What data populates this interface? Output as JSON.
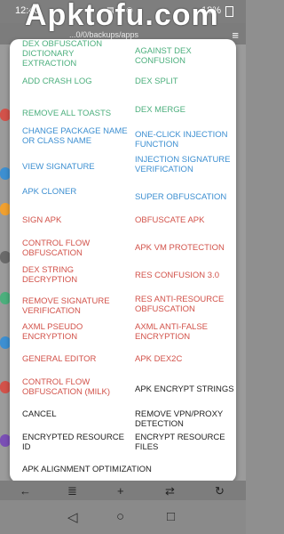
{
  "status": {
    "time": "12:40",
    "battery": "18%"
  },
  "watermark": "Apktofu.com",
  "path": "...0/0/backups/apps",
  "menu": [
    {
      "label": "DEX OBFUSCATION DICTIONARY EXTRACTION",
      "color": "green"
    },
    {
      "label": "AGAINST DEX CONFUSION",
      "color": "green"
    },
    {
      "label": "ADD CRASH LOG",
      "color": "green"
    },
    {
      "label": "DEX SPLIT",
      "color": "green"
    },
    {
      "label": "REMOVE ALL TOASTS",
      "color": "green"
    },
    {
      "label": "DEX MERGE",
      "color": "green"
    },
    {
      "label": "CHANGE PACKAGE NAME OR CLASS NAME",
      "color": "blue"
    },
    {
      "label": "ONE-CLICK INJECTION FUNCTION",
      "color": "blue"
    },
    {
      "label": "VIEW SIGNATURE",
      "color": "blue"
    },
    {
      "label": "INJECTION SIGNATURE VERIFICATION",
      "color": "blue"
    },
    {
      "label": "APK CLONER",
      "color": "blue"
    },
    {
      "label": "SUPER OBFUSCATION",
      "color": "blue"
    },
    {
      "label": "SIGN APK",
      "color": "red"
    },
    {
      "label": "OBFUSCATE APK",
      "color": "red"
    },
    {
      "label": "CONTROL FLOW OBFUSCATION",
      "color": "red"
    },
    {
      "label": "APK VM PROTECTION",
      "color": "red"
    },
    {
      "label": "DEX STRING DECRYPTION",
      "color": "red"
    },
    {
      "label": "RES CONFUSION 3.0",
      "color": "red"
    },
    {
      "label": "REMOVE SIGNATURE VERIFICATION",
      "color": "red"
    },
    {
      "label": "RES ANTI-RESOURCE OBFUSCATION",
      "color": "red"
    },
    {
      "label": "AXML PSEUDO ENCRYPTION",
      "color": "red"
    },
    {
      "label": "AXML ANTI-FALSE ENCRYPTION",
      "color": "red"
    },
    {
      "label": "GENERAL EDITOR",
      "color": "red"
    },
    {
      "label": "APK DEX2C",
      "color": "red"
    },
    {
      "label": "CONTROL FLOW OBFUSCATION (MILK)",
      "color": "red"
    },
    {
      "label": "APK ENCRYPT STRINGS",
      "color": "black"
    },
    {
      "label": "CANCEL",
      "color": "black"
    },
    {
      "label": "REMOVE VPN/PROXY DETECTION",
      "color": "black"
    },
    {
      "label": "ENCRYPTED RESOURCE ID",
      "color": "black"
    },
    {
      "label": "ENCRYPT RESOURCE FILES",
      "color": "black"
    },
    {
      "label": "APK ALIGNMENT OPTIMIZATION",
      "color": "black"
    }
  ],
  "colors": {
    "green": "#4caf7d",
    "blue": "#3d8fd1",
    "red": "#d2524a",
    "black": "#222222"
  }
}
